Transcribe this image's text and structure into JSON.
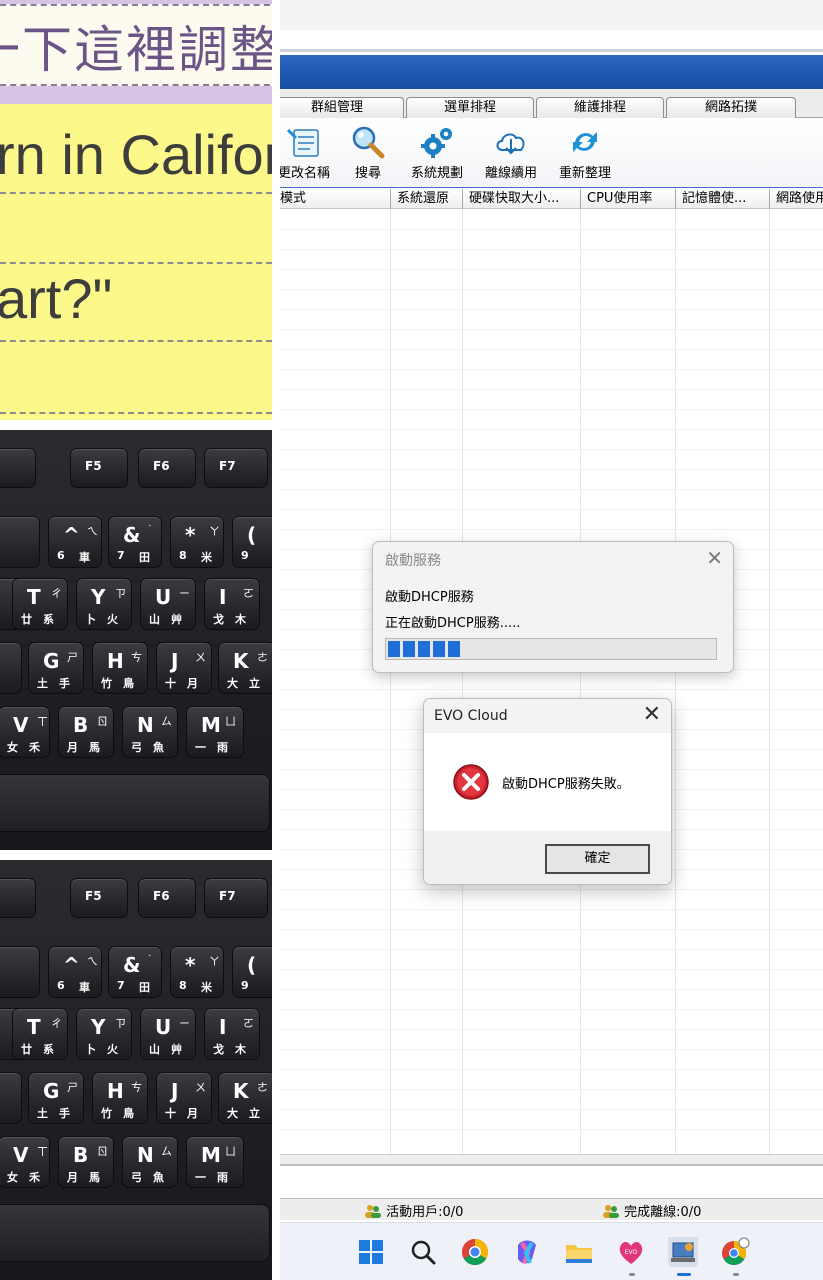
{
  "slide": {
    "title": "一下這裡調整",
    "line1": "rn in California",
    "line2": "art?\""
  },
  "keyboard_top": {
    "fkeys": [
      "F5",
      "F6",
      "F7"
    ],
    "rows": [
      [
        {
          "p": "^",
          "s": "ㄟ",
          "b1": "6",
          "b2": "車"
        },
        {
          "p": "&",
          "s": "˙",
          "b1": "7",
          "b2": "田"
        },
        {
          "p": "*",
          "s": "ㄚ",
          "b1": "8",
          "b2": "米"
        },
        {
          "p": "(",
          "s": "",
          "b1": "9",
          "b2": ""
        }
      ],
      [
        {
          "p": "T",
          "s": "ㄔ",
          "b1": "廿",
          "b2": "系"
        },
        {
          "p": "Y",
          "s": "ㄗ",
          "b1": "卜",
          "b2": "火"
        },
        {
          "p": "U",
          "s": "ㄧ",
          "b1": "山",
          "b2": "艸"
        },
        {
          "p": "I",
          "s": "ㄛ",
          "b1": "戈",
          "b2": "木"
        }
      ],
      [
        {
          "p": "G",
          "s": "ㄕ",
          "b1": "土",
          "b2": "手"
        },
        {
          "p": "H",
          "s": "ㄘ",
          "b1": "竹",
          "b2": "鳥"
        },
        {
          "p": "J",
          "s": "ㄨ",
          "b1": "十",
          "b2": "月"
        },
        {
          "p": "K",
          "s": "ㄜ",
          "b1": "大",
          "b2": "立"
        }
      ],
      [
        {
          "p": "V",
          "s": "ㄒ",
          "b1": "女",
          "b2": "禾"
        },
        {
          "p": "B",
          "s": "ㄖ",
          "b1": "月",
          "b2": "馬"
        },
        {
          "p": "N",
          "s": "ㄙ",
          "b1": "弓",
          "b2": "魚"
        },
        {
          "p": "M",
          "s": "ㄩ",
          "b1": "一",
          "b2": "雨"
        }
      ]
    ]
  },
  "app": {
    "tabs": [
      "群組管理",
      "選單排程",
      "維護排程",
      "網路拓撲"
    ],
    "toolbar": [
      {
        "label": "更改名稱",
        "icon": "rename-icon"
      },
      {
        "label": "搜尋",
        "icon": "search-icon"
      },
      {
        "label": "系統規劃",
        "icon": "gears-icon"
      },
      {
        "label": "離線續用",
        "icon": "cloud-download-icon"
      },
      {
        "label": "重新整理",
        "icon": "refresh-icon"
      }
    ],
    "columns": [
      "模式",
      "系統還原",
      "硬碟快取大小...",
      "CPU使用率",
      "記憶體使...",
      "網路使用"
    ],
    "status": {
      "active_users": "活動用戶:0/0",
      "offline_done": "完成離線:0/0"
    },
    "taskbar": [
      "windows-start-icon",
      "search-icon",
      "chrome-icon",
      "copilot-icon",
      "file-explorer-icon",
      "evo-classic-icon",
      "evo-cloud-icon",
      "chrome-beta-icon"
    ]
  },
  "dialog_service": {
    "title": "啟動服務",
    "line1": "啟動DHCP服務",
    "line2": "正在啟動DHCP服務.....",
    "progress_segments": 5
  },
  "dialog_error": {
    "title": "EVO Cloud",
    "message": "啟動DHCP服務失敗。",
    "ok_label": "確定"
  },
  "colors": {
    "titlebar": "#1c55b0",
    "progress": "#1f6fd6",
    "slide_bg": "#fdf88a",
    "slide_top": "#d6c4e4"
  }
}
